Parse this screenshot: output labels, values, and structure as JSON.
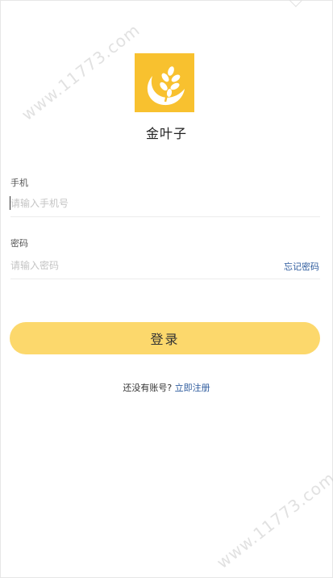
{
  "app": {
    "name": "金叶子",
    "logo_icon": "wheat-leaf-icon",
    "logo_color": "#f8c12f"
  },
  "phone_field": {
    "label": "手机",
    "placeholder": "请输入手机号"
  },
  "password_field": {
    "label": "密码",
    "placeholder": "请输入密码",
    "forgot_label": "忘记密码"
  },
  "login_button": {
    "label": "登录",
    "color": "#fcd86c"
  },
  "register": {
    "prompt": "还没有账号?",
    "link_label": "立即注册",
    "link_color": "#2f5c9e"
  },
  "watermark": {
    "text": "www.11773.com"
  }
}
